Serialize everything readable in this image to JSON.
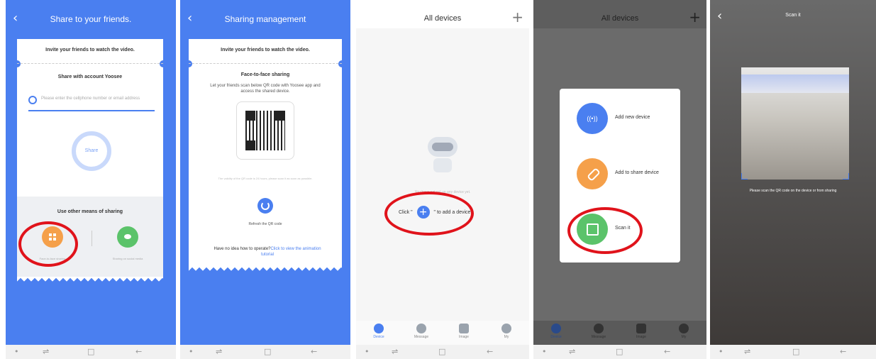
{
  "panel1": {
    "title": "Share to your friends.",
    "card_heading": "Invite your friends to watch the video.",
    "account_heading": "Share with account Yoosee",
    "search_placeholder": "Please enter the cellphone number or email address",
    "share_button": "Share",
    "other_heading": "Use other means of sharing",
    "face_label": "Face-to-face sharing",
    "social_label": "Sharing on social media"
  },
  "panel2": {
    "title": "Sharing management",
    "card_heading": "Invite your friends to watch the video.",
    "section_title": "Face-to-face sharing",
    "instructions": "Let your friends scan below QR code with Yoosee app and access the shared device.",
    "validity": "The validity of the QR code is 24 hours, please scan it as soon as possible.",
    "refresh_label": "Refresh the QR code",
    "help_prefix": "Have no idea how to operate?",
    "help_link": "Click to view the animation tutorial"
  },
  "panel3": {
    "title": "All devices",
    "empty_faint": "You have not set up any device yet.",
    "click_prefix": "Click \"",
    "click_suffix": "\" to add a device.",
    "tabs": [
      "Device",
      "Message",
      "Image",
      "My"
    ]
  },
  "panel4": {
    "title": "All devices",
    "menu": [
      "Add new device",
      "Add to share device",
      "Scan it"
    ],
    "tabs": [
      "Device",
      "Message",
      "Image",
      "My"
    ]
  },
  "panel5": {
    "title": "Scan it",
    "hint": "Please scan the QR code on the device or from sharing"
  },
  "nav_glyphs": {
    "dot": "•",
    "recent": "⇌",
    "home": "□",
    "back": "←"
  },
  "colors": {
    "blue": "#4a7ff0",
    "highlight": "#e0131b",
    "orange": "#f5a04a",
    "green": "#5bc36a"
  }
}
